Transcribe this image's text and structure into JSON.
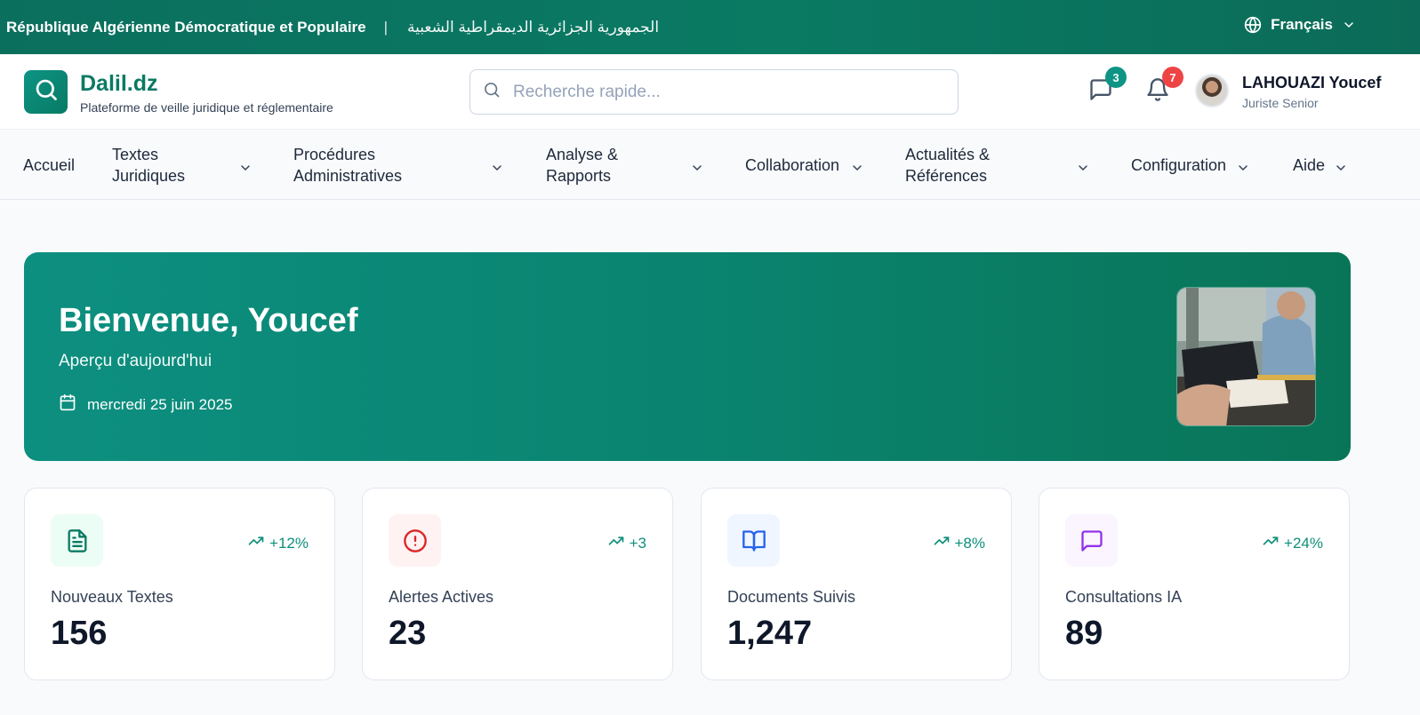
{
  "gov_bar": {
    "title_fr": "République Algérienne Démocratique et Populaire",
    "separator": "|",
    "title_ar": "الجمهورية الجزائرية الديمقراطية الشعبية",
    "language": "Français"
  },
  "header": {
    "brand_name": "Dalil.dz",
    "brand_tagline": "Plateforme de veille juridique et réglementaire",
    "search_placeholder": "Recherche rapide...",
    "messages_count": "3",
    "notifications_count": "7",
    "user_name": "LAHOUAZI Youcef",
    "user_role": "Juriste Senior"
  },
  "nav": {
    "items": [
      {
        "label": "Accueil"
      },
      {
        "label": "Textes Juridiques"
      },
      {
        "label": "Procédures Administratives"
      },
      {
        "label": "Analyse & Rapports"
      },
      {
        "label": "Collaboration"
      },
      {
        "label": "Actualités & Références"
      },
      {
        "label": "Configuration"
      },
      {
        "label": "Aide"
      }
    ]
  },
  "hero": {
    "title": "Bienvenue, Youcef",
    "subtitle": "Aperçu d'aujourd'hui",
    "date": "mercredi 25 juin 2025"
  },
  "stats": [
    {
      "label": "Nouveaux Textes",
      "value": "156",
      "trend": "+12%",
      "icon": "document-icon"
    },
    {
      "label": "Alertes Actives",
      "value": "23",
      "trend": "+3",
      "icon": "alert-circle-icon"
    },
    {
      "label": "Documents Suivis",
      "value": "1,247",
      "trend": "+8%",
      "icon": "book-open-icon"
    },
    {
      "label": "Consultations IA",
      "value": "89",
      "trend": "+24%",
      "icon": "message-square-icon"
    }
  ],
  "colors": {
    "primary": "#0b7a63",
    "badge_messages": "#0d9485",
    "badge_notifications": "#ef4444",
    "trend": "#0d8f7a"
  }
}
